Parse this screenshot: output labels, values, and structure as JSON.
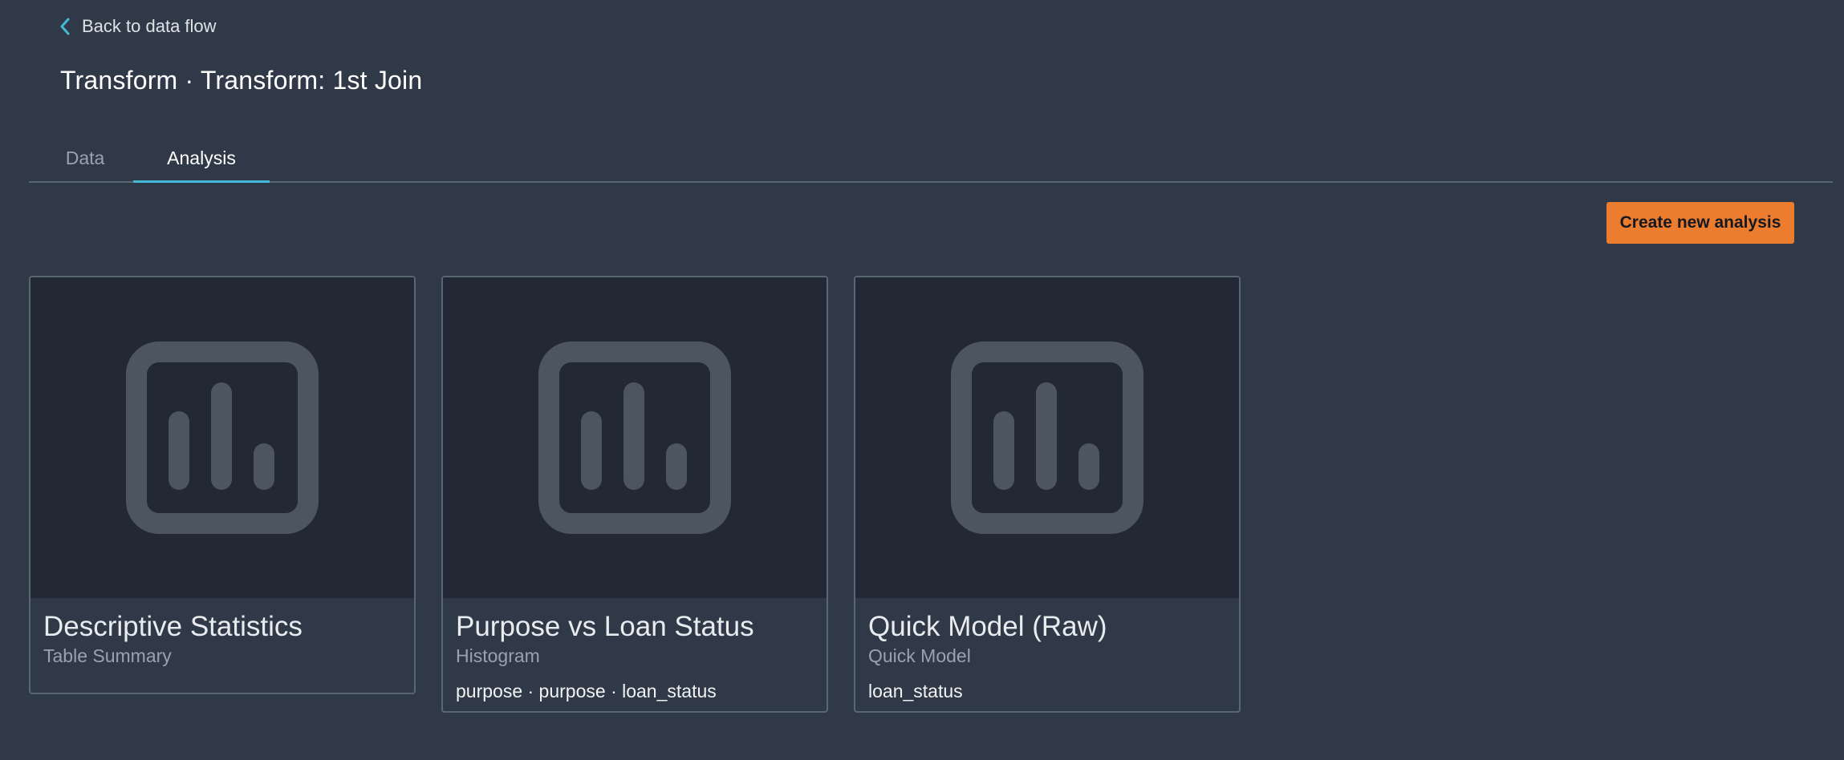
{
  "back_link": {
    "label": "Back to data flow",
    "icon": "chevron-left-icon"
  },
  "page_title": "Transform · Transform: 1st Join",
  "tabs": [
    {
      "label": "Data",
      "selected": false
    },
    {
      "label": "Analysis",
      "selected": true
    }
  ],
  "create_button": {
    "label": "Create new analysis"
  },
  "cards": [
    {
      "title": "Descriptive Statistics",
      "subtitle": "Table Summary",
      "meta": "",
      "icon": "bar-chart-icon"
    },
    {
      "title": "Purpose vs Loan Status",
      "subtitle": "Histogram",
      "meta": "purpose · purpose · loan_status",
      "icon": "bar-chart-icon"
    },
    {
      "title": "Quick Model (Raw)",
      "subtitle": "Quick Model",
      "meta": "loan_status",
      "icon": "bar-chart-icon"
    }
  ],
  "colors": {
    "background": "#2f3948",
    "thumbnail_background": "#222934",
    "accent_tab": "#44b9d6",
    "primary_button": "#ec7c2e",
    "card_border": "#5a6672",
    "icon_gray": "#4d5561"
  }
}
